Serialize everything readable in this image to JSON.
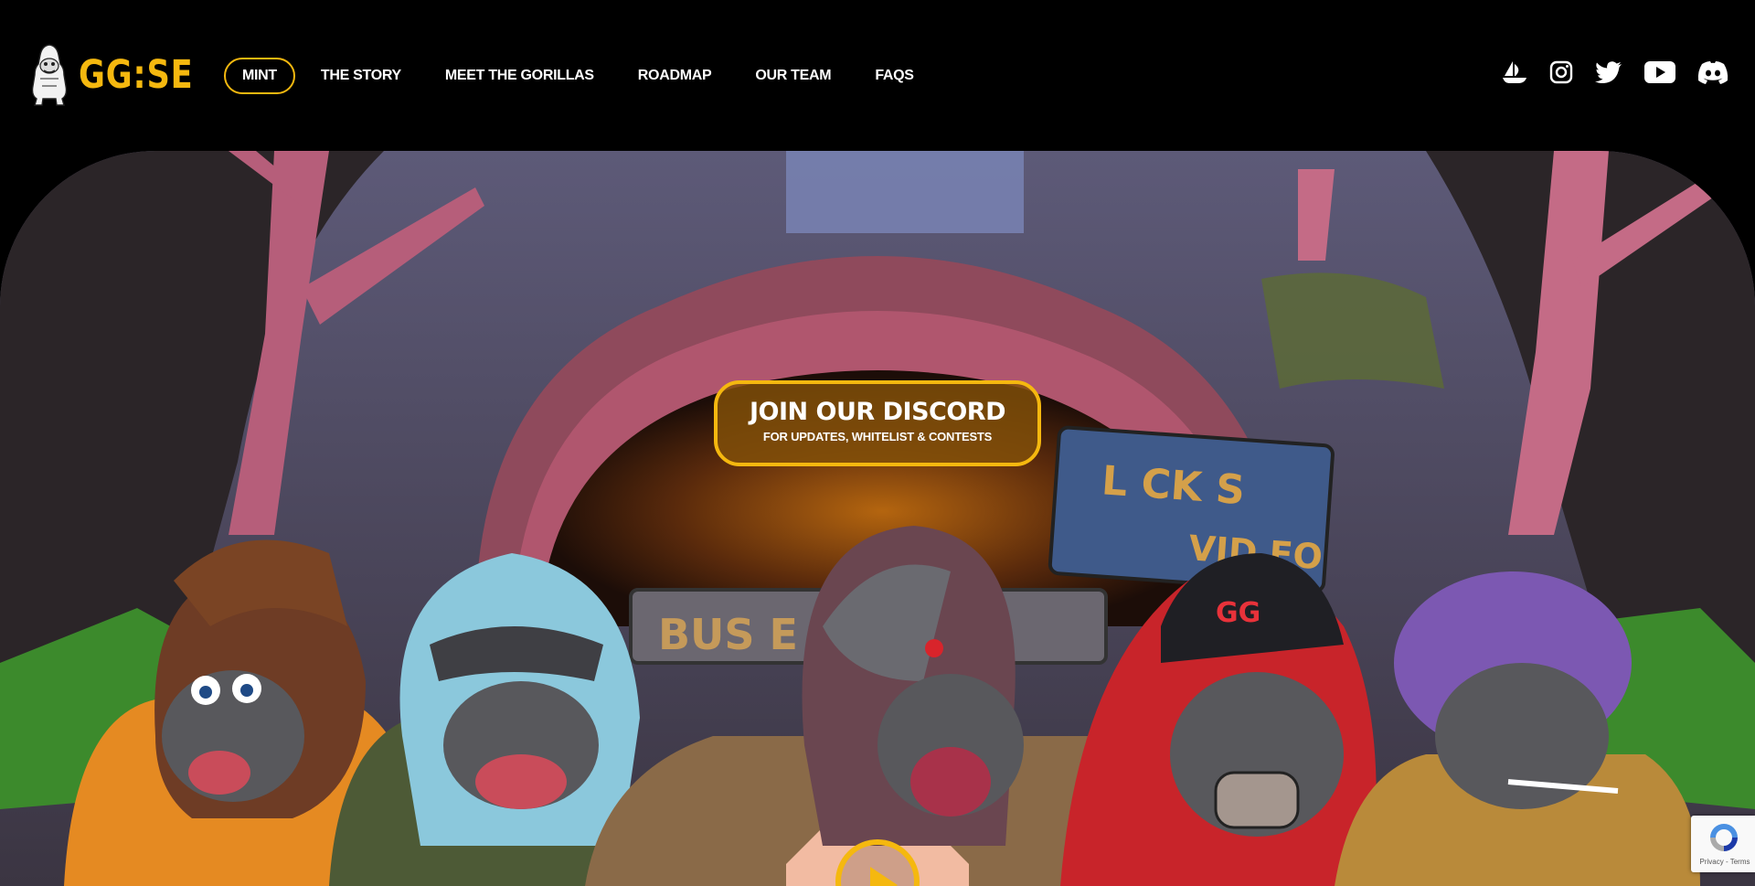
{
  "brand": {
    "logo_text": "GG:SE",
    "accent_color": "#f5b80f"
  },
  "nav": {
    "items": [
      {
        "label": "MINT",
        "active": true
      },
      {
        "label": "THE STORY"
      },
      {
        "label": "MEET THE GORILLAS"
      },
      {
        "label": "ROADMAP"
      },
      {
        "label": "OUR TEAM"
      },
      {
        "label": "FAQS"
      }
    ]
  },
  "socials": [
    {
      "icon": "opensea-icon"
    },
    {
      "icon": "instagram-icon"
    },
    {
      "icon": "twitter-icon"
    },
    {
      "icon": "youtube-icon"
    },
    {
      "icon": "discord-icon"
    }
  ],
  "hero": {
    "cta_title": "JOIN OUR DISCORD",
    "cta_subtitle": "FOR UPDATES, WHITELIST & CONTESTS",
    "sign_text_top": "L CK  S",
    "sign_text_bottom": "VID EO",
    "bus_sign_text": "BUS E",
    "cap_text": "GG"
  },
  "recaptcha": {
    "links": "Privacy - Terms"
  }
}
